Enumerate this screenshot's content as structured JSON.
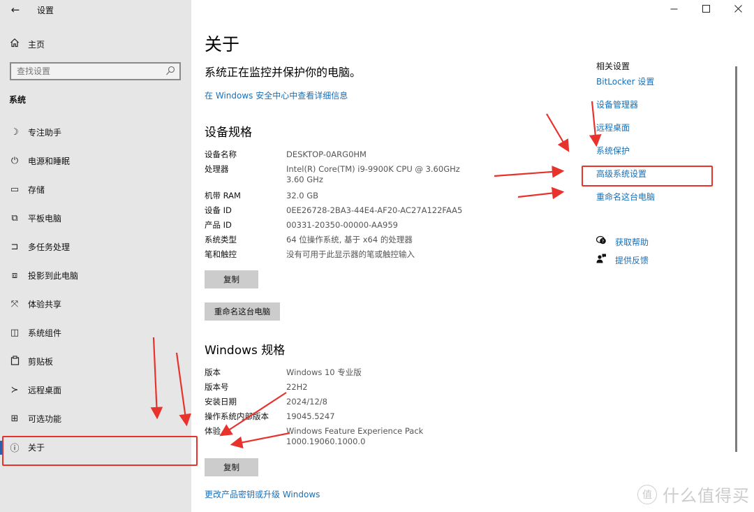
{
  "window": {
    "app_title": "设置",
    "back_icon": "arrow-left-icon",
    "minimize_glyph": "—",
    "maximize_glyph": "☐",
    "close_glyph": "✕"
  },
  "sidebar": {
    "home_label": "主页",
    "search_placeholder": "查找设置",
    "section_label": "系统",
    "items": [
      {
        "label": "专注助手",
        "icon": "moon-icon",
        "glyph": "☽"
      },
      {
        "label": "电源和睡眠",
        "icon": "power-icon",
        "glyph": "⏻"
      },
      {
        "label": "存储",
        "icon": "storage-icon",
        "glyph": "▭"
      },
      {
        "label": "平板电脑",
        "icon": "tablet-icon",
        "glyph": "⧉"
      },
      {
        "label": "多任务处理",
        "icon": "multitasking-icon",
        "glyph": "⊐"
      },
      {
        "label": "投影到此电脑",
        "icon": "projecting-icon",
        "glyph": "⧈"
      },
      {
        "label": "体验共享",
        "icon": "shared-experiences-icon",
        "glyph": "⤧"
      },
      {
        "label": "系统组件",
        "icon": "system-components-icon",
        "glyph": "◫"
      },
      {
        "label": "剪贴板",
        "icon": "clipboard-icon",
        "glyph": "📋"
      },
      {
        "label": "远程桌面",
        "icon": "remote-desktop-icon",
        "glyph": "≻"
      },
      {
        "label": "可选功能",
        "icon": "optional-features-icon",
        "glyph": "⊞"
      },
      {
        "label": "关于",
        "icon": "info-icon",
        "glyph": "ⓘ",
        "selected": true
      }
    ]
  },
  "main": {
    "title": "关于",
    "protect_text": "系统正在监控并保护你的电脑。",
    "security_link": "在 Windows 安全中心中查看详细信息",
    "device_specs": {
      "heading": "设备规格",
      "rows": [
        {
          "key": "设备名称",
          "value": "DESKTOP-0ARG0HM"
        },
        {
          "key": "处理器",
          "value": "Intel(R) Core(TM) i9-9900K CPU @ 3.60GHz   3.60 GHz"
        },
        {
          "key": "机带 RAM",
          "value": "32.0 GB"
        },
        {
          "key": "设备 ID",
          "value": "0EE26728-2BA3-44E4-AF20-AC27A122FAA5"
        },
        {
          "key": "产品 ID",
          "value": "00331-20350-00000-AA959"
        },
        {
          "key": "系统类型",
          "value": "64 位操作系统, 基于 x64 的处理器"
        },
        {
          "key": "笔和触控",
          "value": "没有可用于此显示器的笔或触控输入"
        }
      ],
      "copy_button": "复制",
      "rename_button": "重命名这台电脑"
    },
    "windows_specs": {
      "heading": "Windows 规格",
      "rows": [
        {
          "key": "版本",
          "value": "Windows 10 专业版"
        },
        {
          "key": "版本号",
          "value": "22H2"
        },
        {
          "key": "安装日期",
          "value": "2024/12/8"
        },
        {
          "key": "操作系统内部版本",
          "value": "19045.5247"
        },
        {
          "key": "体验",
          "value": "Windows Feature Experience Pack 1000.19060.1000.0"
        }
      ],
      "copy_button": "复制"
    },
    "upgrade_link": "更改产品密钥或升级 Windows"
  },
  "related": {
    "title": "相关设置",
    "links": [
      "BitLocker 设置",
      "设备管理器",
      "远程桌面",
      "系统保护",
      "高级系统设置",
      "重命名这台电脑"
    ],
    "help": [
      {
        "label": "获取帮助",
        "icon": "get-help-icon",
        "glyph": "💬"
      },
      {
        "label": "提供反馈",
        "icon": "feedback-icon",
        "glyph": "👤"
      }
    ]
  },
  "annotation": {
    "color": "#e8322c",
    "highlighted_sidebar_item": "关于",
    "highlighted_related_link": "高级系统设置"
  },
  "watermark": {
    "logo_glyph": "值",
    "text": "什么值得买"
  }
}
